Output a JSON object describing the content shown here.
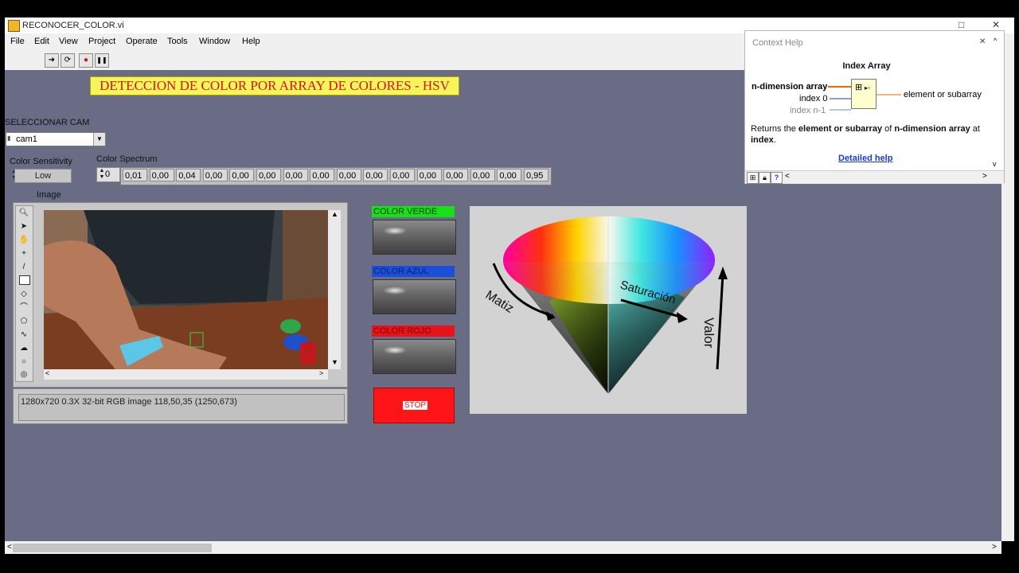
{
  "window": {
    "title": "RECONOCER_COLOR.vi",
    "controls": [
      "□",
      "✕"
    ]
  },
  "menu": [
    "File",
    "Edit",
    "View",
    "Project",
    "Operate",
    "Tools",
    "Window",
    "Help"
  ],
  "toolbar": {
    "run": "➜",
    "run_continuous": "⟳",
    "abort": "●",
    "pause": "❚❚"
  },
  "front_panel": {
    "banner": "DETECCION DE COLOR POR ARRAY DE COLORES - HSV",
    "select_cam": {
      "label": "SELECCIONAR CAM",
      "value": "cam1"
    },
    "color_sensitivity": {
      "label": "Color Sensitivity",
      "value": "Low"
    },
    "color_spectrum": {
      "label": "Color Spectrum",
      "index": "0",
      "values": [
        "0,01",
        "0,00",
        "0,04",
        "0,00",
        "0,00",
        "0,00",
        "0,00",
        "0,00",
        "0,00",
        "0,00",
        "0,00",
        "0,00",
        "0,00",
        "0,00",
        "0,00",
        "0,95"
      ]
    },
    "image": {
      "label": "Image",
      "status": "1280x720 0.3X 32-bit RGB image 118,50,35     (1250,673)"
    },
    "indicators": [
      {
        "label": "COLOR VERDE",
        "color": "#18e018",
        "text_color": "#0a3a0a"
      },
      {
        "label": "COLOR AZUL",
        "color": "#1c4fd6",
        "text_color": "#0a1f78"
      },
      {
        "label": "COLOR ROJO",
        "color": "#e8141a",
        "text_color": "#7a0000"
      }
    ],
    "stop": "STOP",
    "hsv": {
      "matiz": "Matiz",
      "saturacion": "Saturación",
      "valor": "Valor"
    }
  },
  "context_help": {
    "header": "Context Help",
    "title": "Index Array",
    "terminal_array": "n-dimension array",
    "terminal_index0": "index 0",
    "terminal_indexn": "index n-1",
    "terminal_out": "element or subarray",
    "desc_1": "Returns the ",
    "desc_b1": "element or subarray",
    "desc_2": " of ",
    "desc_b2": "n-dimension array",
    "desc_3": " at ",
    "desc_b3": "index",
    "desc_4": ".",
    "link": "Detailed help"
  }
}
